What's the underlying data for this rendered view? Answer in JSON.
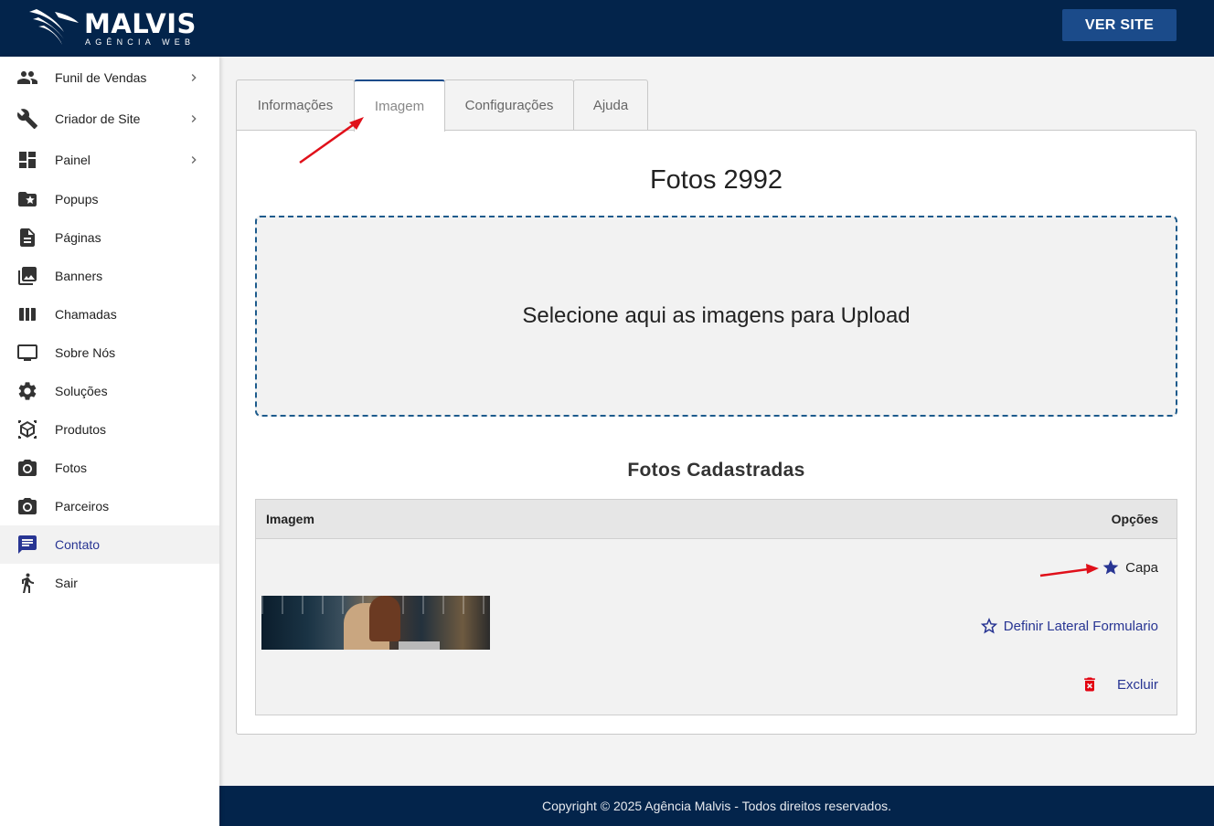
{
  "header": {
    "brand": "MALVIS",
    "brand_sub": "AGÊNCIA WEB",
    "ver_site_label": "VER SITE"
  },
  "sidebar": {
    "items": [
      {
        "label": "Funil de Vendas",
        "icon": "people-icon",
        "chevron": true
      },
      {
        "label": "Criador de Site",
        "icon": "wrench-icon",
        "chevron": true
      },
      {
        "label": "Painel",
        "icon": "dashboard-icon",
        "chevron": true
      },
      {
        "label": "Popups",
        "icon": "folder-star-icon"
      },
      {
        "label": "Páginas",
        "icon": "document-icon"
      },
      {
        "label": "Banners",
        "icon": "photo-library-icon"
      },
      {
        "label": "Chamadas",
        "icon": "columns-icon"
      },
      {
        "label": "Sobre Nós",
        "icon": "monitor-icon"
      },
      {
        "label": "Soluções",
        "icon": "gear-icon"
      },
      {
        "label": "Produtos",
        "icon": "package-icon"
      },
      {
        "label": "Fotos",
        "icon": "camera-icon"
      },
      {
        "label": "Parceiros",
        "icon": "camera-icon"
      },
      {
        "label": "Contato",
        "icon": "chat-icon",
        "active": true
      },
      {
        "label": "Sair",
        "icon": "exit-person-icon"
      }
    ]
  },
  "tabs": [
    {
      "label": "Informações"
    },
    {
      "label": "Imagem",
      "active": true
    },
    {
      "label": "Configurações"
    },
    {
      "label": "Ajuda"
    }
  ],
  "panel": {
    "title": "Fotos 2992",
    "dropzone_text": "Selecione aqui as imagens para Upload",
    "section_title": "Fotos Cadastradas",
    "table": {
      "col_image": "Imagem",
      "col_options": "Opções",
      "row": {
        "capa_label": "Capa",
        "lateral_label": "Definir Lateral Formulario",
        "excluir_label": "Excluir"
      }
    }
  },
  "footer": {
    "text": "Copyright © 2025 Agência Malvis - Todos direitos reservados."
  },
  "colors": {
    "navy": "#03244b",
    "button": "#1b4b8a",
    "accent": "#283593",
    "delete": "#e3000f",
    "arrow": "#e0101a"
  }
}
